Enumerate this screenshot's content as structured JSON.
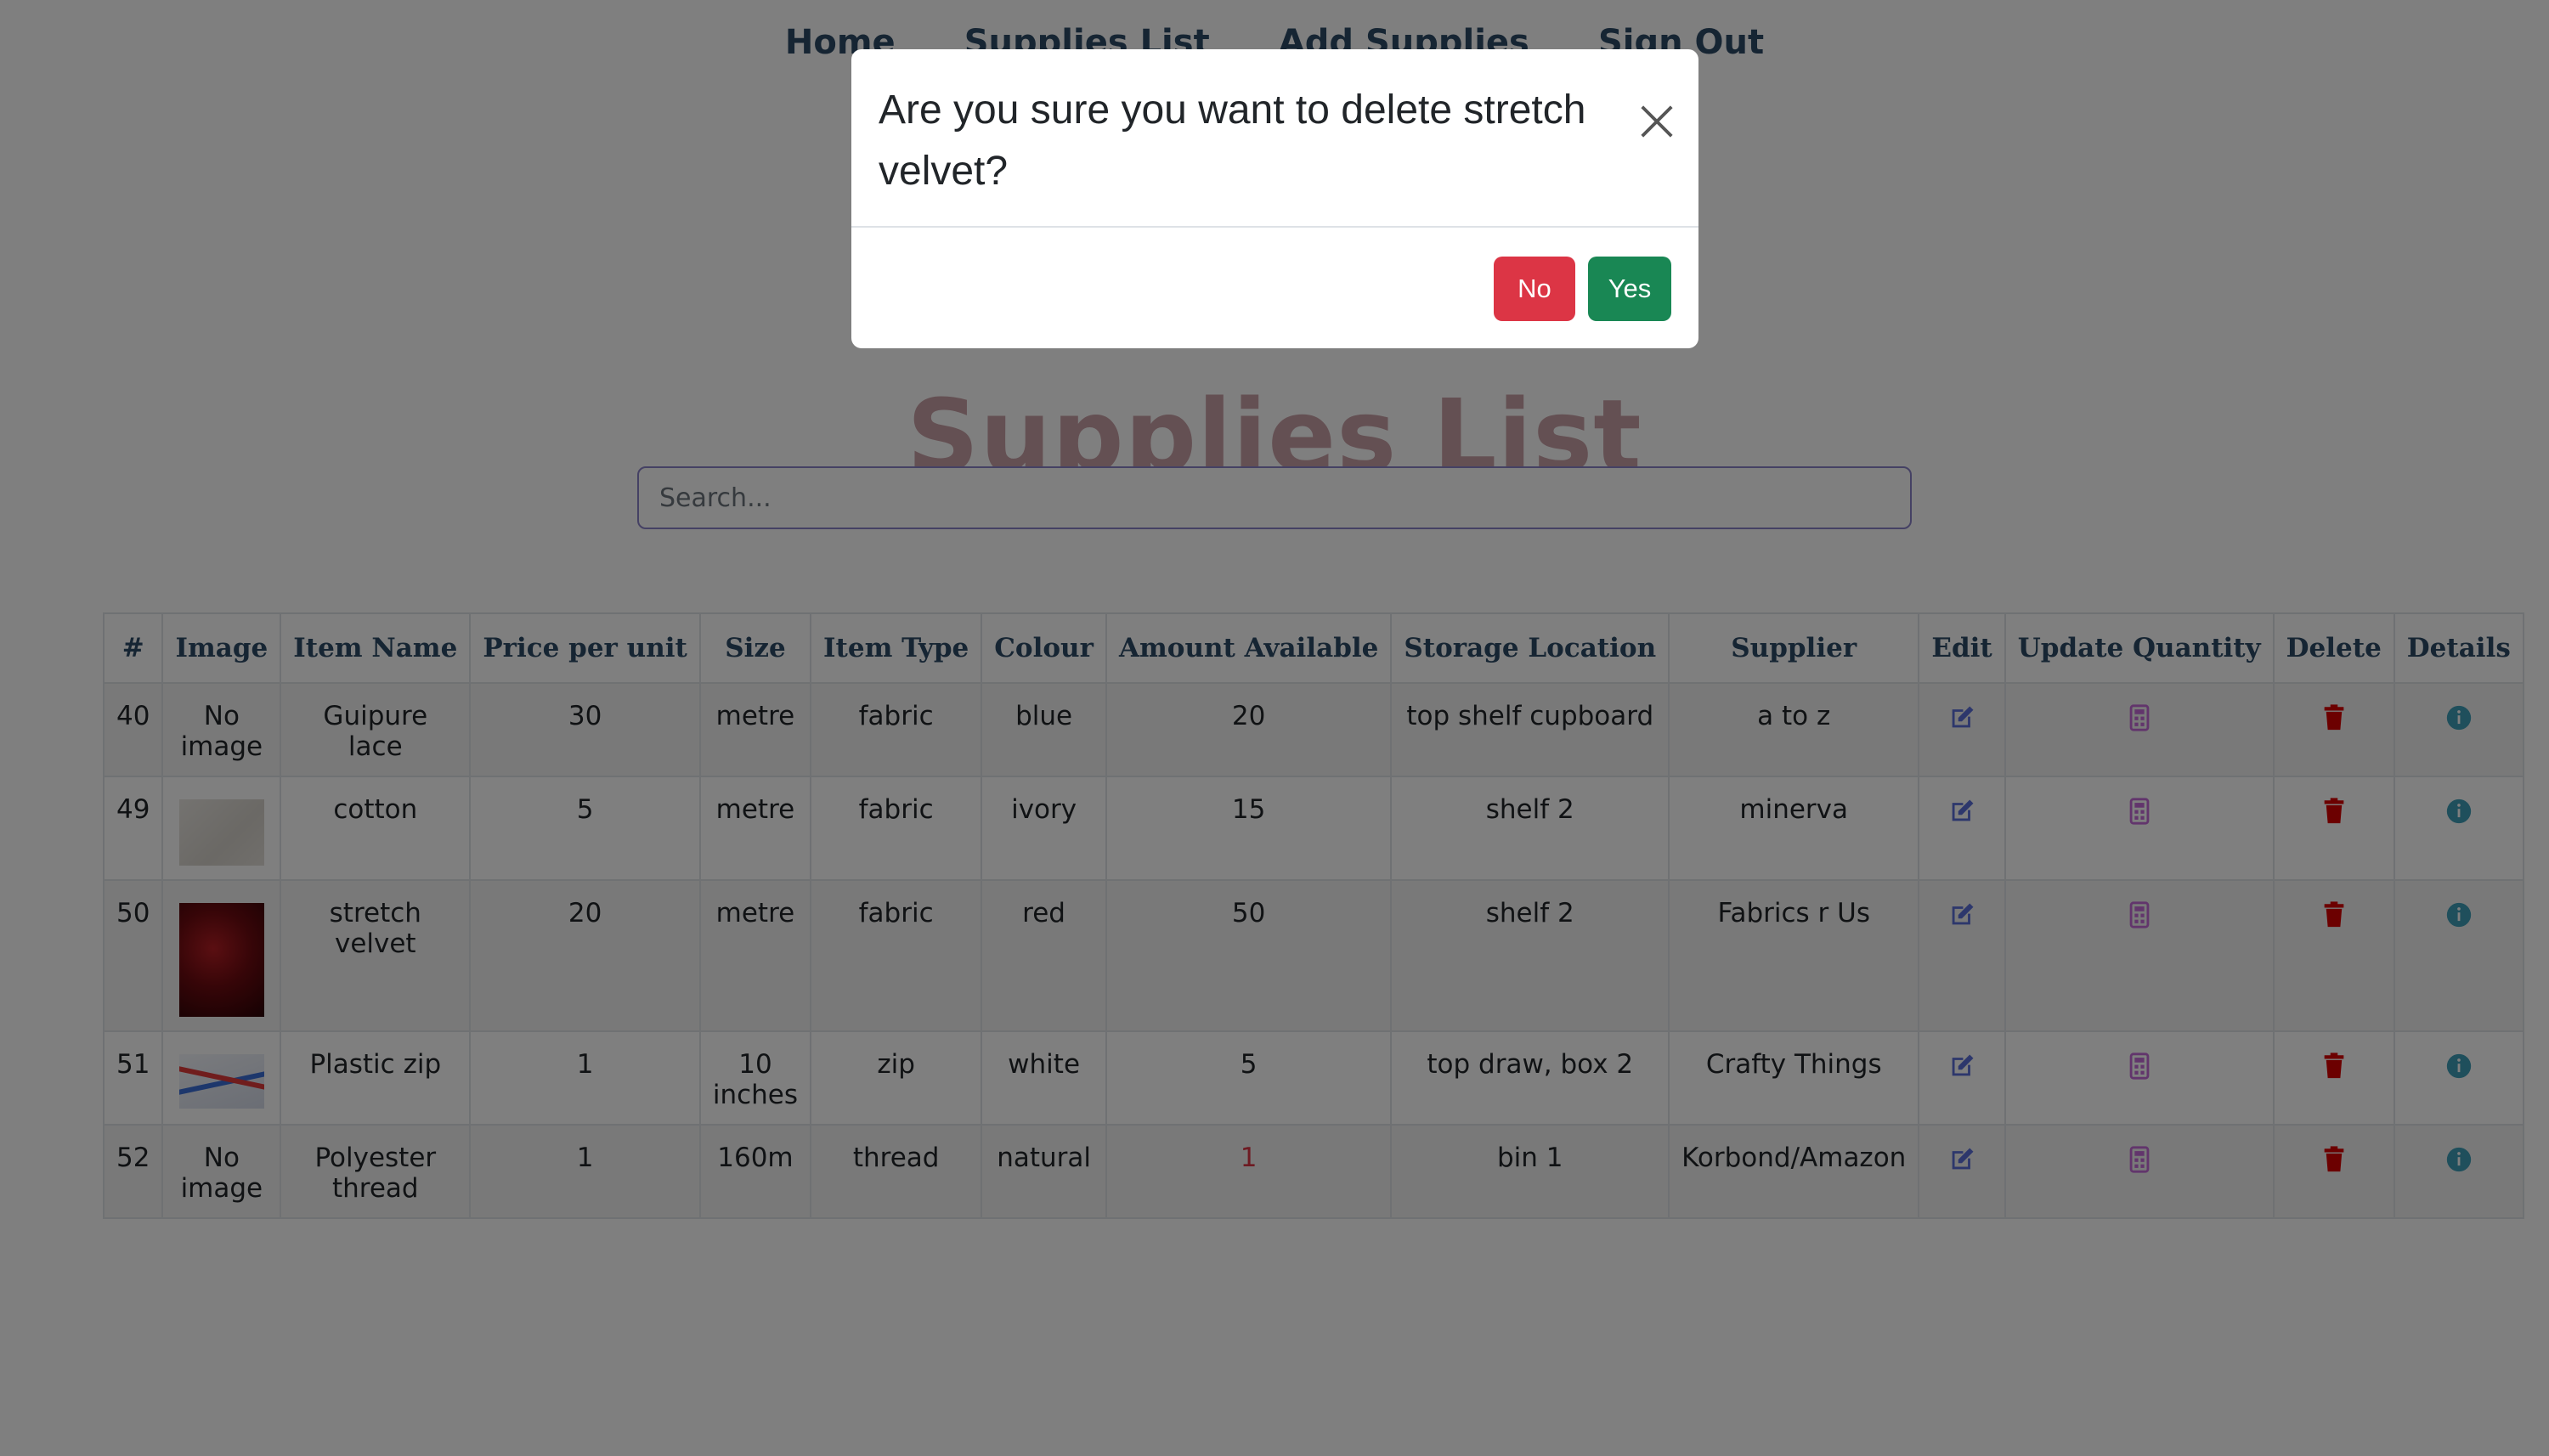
{
  "nav": [
    "Home",
    "Supplies List",
    "Add Supplies",
    "Sign Out"
  ],
  "page_title": "Supplies List",
  "search": {
    "placeholder": "Search..."
  },
  "table": {
    "headers": [
      "#",
      "Image",
      "Item Name",
      "Price per unit",
      "Size",
      "Item Type",
      "Colour",
      "Amount Available",
      "Storage Location",
      "Supplier",
      "Edit",
      "Update Quantity",
      "Delete",
      "Details"
    ],
    "rows": [
      {
        "id": "40",
        "image": "No image",
        "name": "Guipure lace",
        "price": "30",
        "size": "metre",
        "type": "fabric",
        "colour": "blue",
        "amount": "20",
        "location": "top shelf cupboard",
        "supplier": "a to z"
      },
      {
        "id": "49",
        "image": "",
        "name": "cotton",
        "price": "5",
        "size": "metre",
        "type": "fabric",
        "colour": "ivory",
        "amount": "15",
        "location": "shelf 2",
        "supplier": "minerva"
      },
      {
        "id": "50",
        "image": "",
        "name": "stretch velvet",
        "price": "20",
        "size": "metre",
        "type": "fabric",
        "colour": "red",
        "amount": "50",
        "location": "shelf 2",
        "supplier": "Fabrics r Us"
      },
      {
        "id": "51",
        "image": "",
        "name": "Plastic zip",
        "price": "1",
        "size": "10 inches",
        "type": "zip",
        "colour": "white",
        "amount": "5",
        "location": "top draw, box 2",
        "supplier": "Crafty Things"
      },
      {
        "id": "52",
        "image": "No image",
        "name": "Polyester thread",
        "price": "1",
        "size": "160m",
        "type": "thread",
        "colour": "natural",
        "amount": "1",
        "location": "bin 1",
        "supplier": "Korbond/Amazon"
      }
    ],
    "icons": {
      "edit": "edit-icon",
      "update": "calculator-icon",
      "delete": "trash-icon",
      "details": "info-icon"
    }
  },
  "modal": {
    "title": "Are you sure you want to delete stretch velvet?",
    "no_label": "No",
    "yes_label": "Yes"
  },
  "colors": {
    "no": "#dc3545",
    "yes": "#198754",
    "low_stock": "#dc3545",
    "edit_icon": "#5b6fd8",
    "update_icon": "#c56ad9",
    "delete_icon": "#d90000",
    "details_icon": "#3f9fb8"
  }
}
